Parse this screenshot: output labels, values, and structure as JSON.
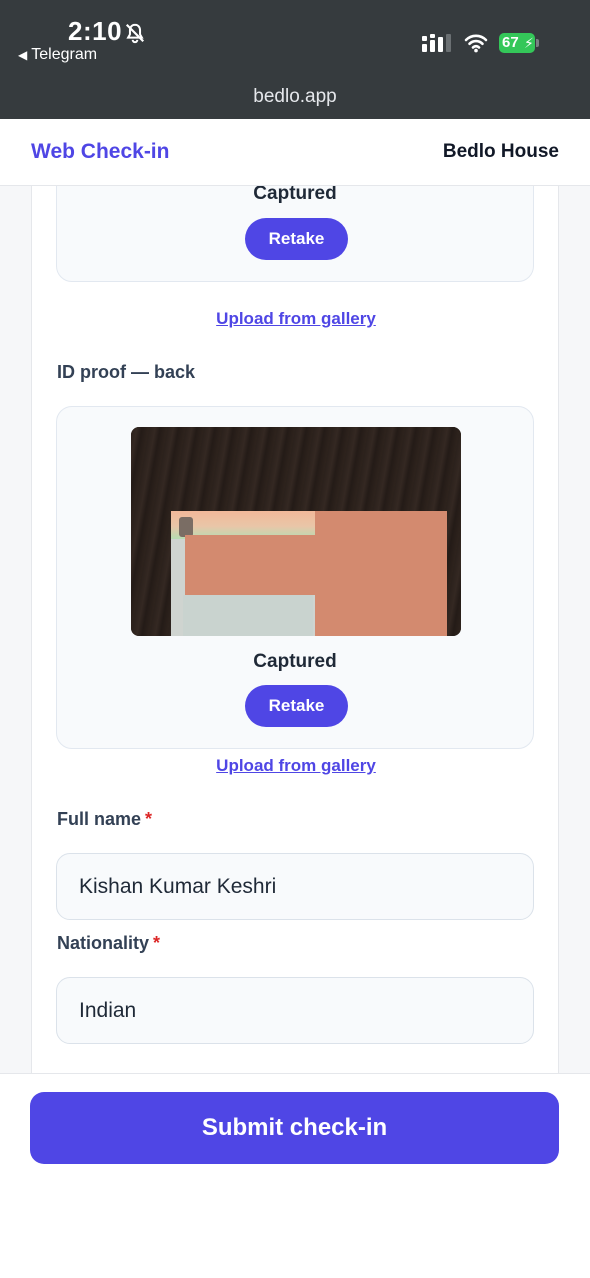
{
  "status_bar": {
    "time": "2:10",
    "back_app": "Telegram",
    "battery": "67",
    "url": "bedlo.app"
  },
  "header": {
    "brand": "Web Check-in",
    "property": "Bedlo House"
  },
  "id_front": {
    "status": "Captured",
    "retake_label": "Retake",
    "gallery_link": "Upload from gallery"
  },
  "id_back": {
    "label": "ID proof — back",
    "status": "Captured",
    "retake_label": "Retake",
    "gallery_link": "Upload from gallery"
  },
  "full_name": {
    "label": "Full name",
    "required_mark": "*",
    "value": "Kishan Kumar Keshri"
  },
  "nationality": {
    "label": "Nationality",
    "required_mark": "*",
    "value": "Indian"
  },
  "footer": {
    "submit_label": "Submit check-in"
  },
  "colors": {
    "accent": "#4f46e5",
    "required": "#dc2626",
    "battery": "#34c759"
  },
  "icons": [
    "bell-slash-icon",
    "back-triangle-icon",
    "cellular-signal-icon",
    "wifi-icon",
    "battery-icon",
    "charging-bolt-icon"
  ]
}
